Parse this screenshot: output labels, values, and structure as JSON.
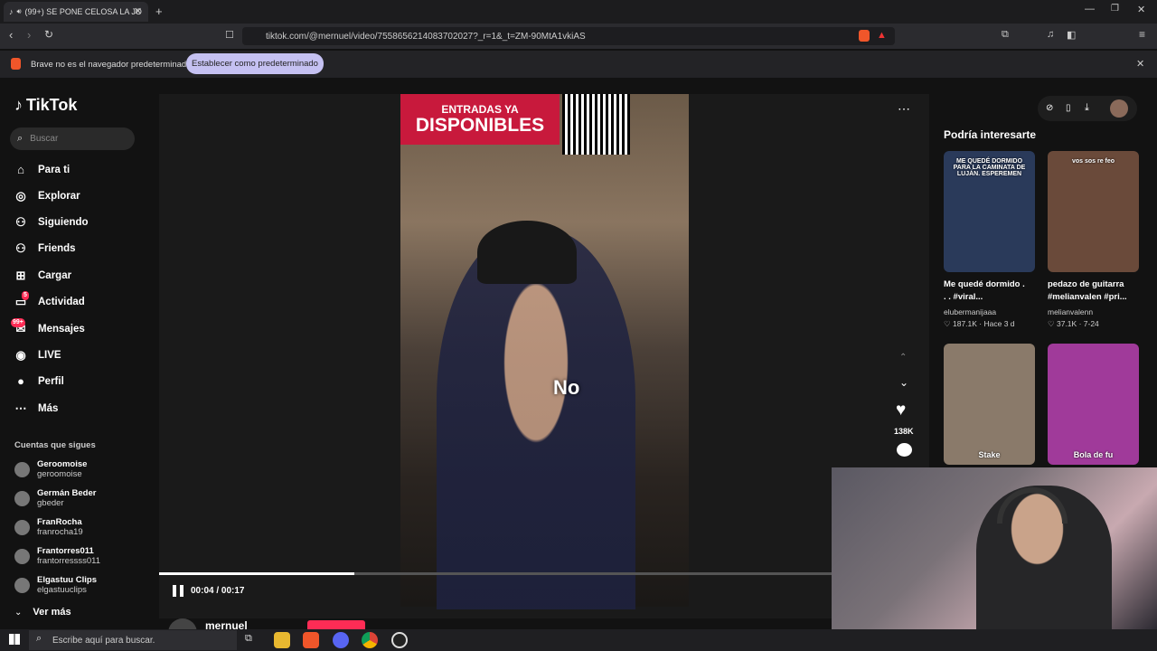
{
  "browser": {
    "tab_title": "(99+) SE PONE CELOSA LA JO",
    "url": "tiktok.com/@mernuel/video/7558656214083702027?_r=1&_t=ZM-90MtA1vkiAS",
    "infobar_text": "Brave no es el navegador predeterminado",
    "infobar_button": "Establecer como predeterminado"
  },
  "tiktok": {
    "logo": "TikTok",
    "search_placeholder": "Buscar",
    "nav": [
      {
        "label": "Para ti",
        "icon": "home-icon"
      },
      {
        "label": "Explorar",
        "icon": "compass-icon"
      },
      {
        "label": "Siguiendo",
        "icon": "following-icon"
      },
      {
        "label": "Friends",
        "icon": "friends-icon"
      },
      {
        "label": "Cargar",
        "icon": "upload-icon"
      },
      {
        "label": "Actividad",
        "icon": "activity-icon",
        "badge": "5"
      },
      {
        "label": "Mensajes",
        "icon": "messages-icon",
        "badge": "99+"
      },
      {
        "label": "LIVE",
        "icon": "live-icon"
      },
      {
        "label": "Perfil",
        "icon": "avatar-icon"
      },
      {
        "label": "Más",
        "icon": "more-icon"
      }
    ],
    "following_header": "Cuentas que sigues",
    "following": [
      {
        "name": "Geroomoise",
        "user": "geroomoise"
      },
      {
        "name": "Germán Beder",
        "user": "gbeder"
      },
      {
        "name": "FranRocha",
        "user": "franrocha19"
      },
      {
        "name": "Frantorres011",
        "user": "frantorressss011"
      },
      {
        "name": "Elgastuu Clips",
        "user": "elgastuuclips"
      }
    ],
    "see_more": "Ver más"
  },
  "video": {
    "banner_line1": "ENTRADAS YA",
    "banner_line2": "DISPONIBLES",
    "subtitle": "No",
    "time": "00:04 / 00:17",
    "progress": 0.29,
    "likes": "138K",
    "author": "mernuel"
  },
  "recommendations": {
    "header": "Podría interesarte",
    "items": [
      {
        "title1": "Me quedé dormido .",
        "title2": ". . #viral...",
        "author": "elubermanijaaa",
        "likes": "187.1K",
        "date": "Hace 3 d",
        "overlay": "ME QUEDÉ DORMIDO PARA LA CAMINATA DE LUJÁN. ESPEREMEN",
        "color": "#2a3a5a"
      },
      {
        "title1": "pedazo de guitarra",
        "title2": "#melianvalen #pri...",
        "author": "melianvalenn",
        "likes": "37.1K",
        "date": "7-24",
        "overlay": "vos sos re feo",
        "color": "#6a4a3a"
      },
      {
        "title1": "",
        "title2": "",
        "author": "",
        "likes": "",
        "date": "",
        "overlay": "Stake",
        "color": "#8a7a6a"
      },
      {
        "title1": "",
        "title2": "",
        "author": "",
        "likes": "",
        "date": "",
        "overlay": "Bola de fu",
        "color": "#a03a9a"
      }
    ]
  },
  "taskbar": {
    "search_placeholder": "Escribe aquí para buscar."
  }
}
